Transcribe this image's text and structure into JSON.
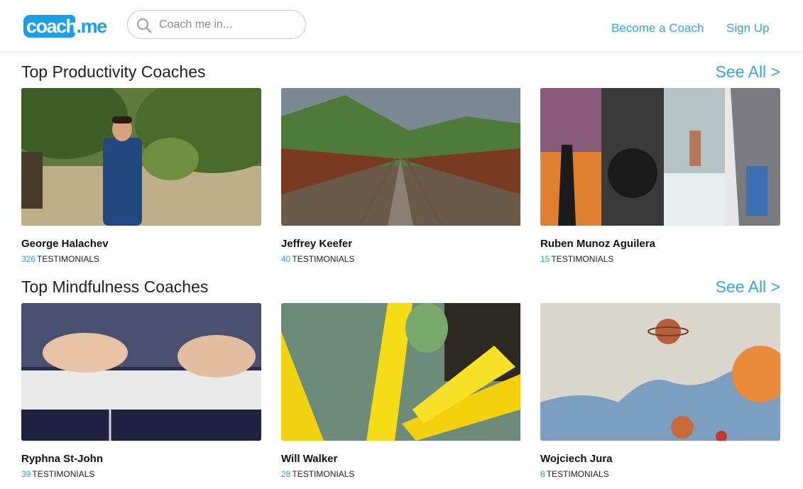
{
  "header": {
    "logo_main": "coach",
    "logo_dot": ".",
    "logo_tail": "me",
    "search_placeholder": "Coach me in...",
    "nav": [
      "Become a Coach",
      "Sign Up"
    ]
  },
  "sections": [
    {
      "title": "Top Productivity Coaches",
      "see_all": "See All >",
      "coaches": [
        {
          "name": "George Halachev",
          "count": "326",
          "label": "TESTIMONIALS",
          "image": "man-in-garden"
        },
        {
          "name": "Jeffrey Keefer",
          "count": "40",
          "label": "TESTIMONIALS",
          "image": "railway-tracks"
        },
        {
          "name": "Ruben Munoz Aguilera",
          "count": "15",
          "label": "TESTIMONIALS",
          "image": "collage"
        }
      ]
    },
    {
      "title": "Top Mindfulness Coaches",
      "see_all": "See All >",
      "coaches": [
        {
          "name": "Ryphna St-John",
          "count": "39",
          "label": "TESTIMONIALS",
          "image": "hands-on-keyboard"
        },
        {
          "name": "Will Walker",
          "count": "28",
          "label": "TESTIMONIALS",
          "image": "yellow-flower"
        },
        {
          "name": "Wojciech Jura",
          "count": "8",
          "label": "TESTIMONIALS",
          "image": "child-drawing-space"
        }
      ]
    }
  ],
  "colors": {
    "accent": "#3aa3e0",
    "logo": "#1aa0e6"
  }
}
